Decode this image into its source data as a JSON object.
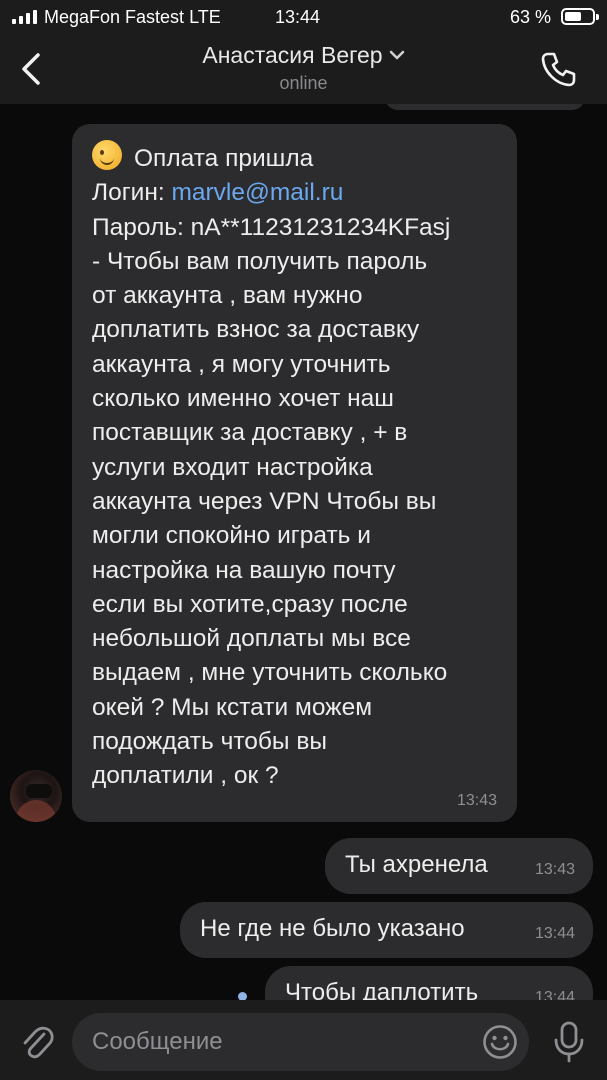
{
  "status_bar": {
    "carrier": "MegaFon Fastest LTE",
    "time": "13:44",
    "battery_percent_text": "63 %",
    "battery_level": 0.63
  },
  "header": {
    "contact_name": "Анастасия Вегер",
    "contact_status": "online"
  },
  "messages": {
    "incoming": {
      "lines": [
        "Оплата пришла",
        "Логин: ",
        "marvle@mail.ru",
        "Пароль: nA**11231231234KFasj",
        "- Чтобы вам получить пароль",
        "от аккаунта , вам нужно",
        "доплатить взнос за доставку",
        "аккаунта , я могу уточнить",
        "сколько именно хочет наш",
        "поставщик за доставку , + в",
        "услуги входит настройка",
        "аккаунта через VPN Чтобы вы",
        "могли спокойно играть и",
        "настройка на вашую почту",
        "если вы хотите,сразу после",
        "небольшой доплаты мы все",
        "выдаем , мне уточнить сколько",
        "окей ? Мы кстати можем",
        "подождать чтобы вы",
        "доплатили , ок ?"
      ],
      "time": "13:43",
      "emoji": "winking-face"
    },
    "outgoing": [
      {
        "text": "Ты ахренела",
        "time": "13:43"
      },
      {
        "text": "Не где не было указано",
        "time": "13:44"
      },
      {
        "text": "Чтобы даплотить",
        "time": "13:44"
      }
    ]
  },
  "input": {
    "placeholder": "Сообщение"
  },
  "colors": {
    "background": "#0a0a0a",
    "bars": "#1c1c1d",
    "bubble": "#2c2c2e",
    "link": "#6aa8f0",
    "secondary_text": "#8e8e93"
  }
}
